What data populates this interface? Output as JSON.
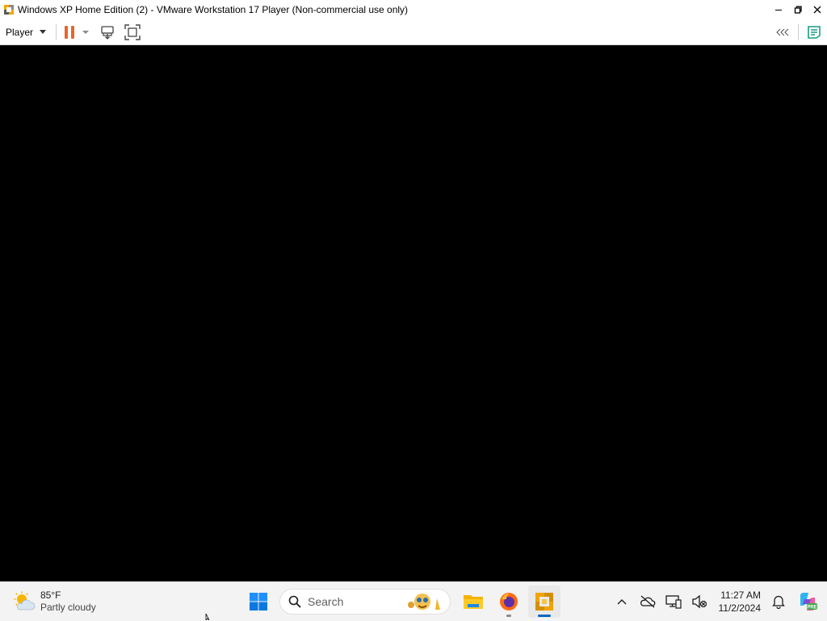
{
  "window": {
    "title": "Windows XP Home Edition (2) - VMware Workstation 17 Player (Non-commercial use only)",
    "controls": [
      "minimize-icon",
      "restore-icon",
      "close-icon"
    ]
  },
  "toolbar": {
    "player_label": "Player",
    "buttons": [
      "pause-icon",
      "send-ctrl-alt-del-icon",
      "full-screen-icon"
    ],
    "right_buttons": [
      "collapse-toolbar-icon",
      "unity-icon"
    ],
    "accent_color": "#e8662c"
  },
  "vm": {
    "screen_color": "#000000"
  },
  "taskbar": {
    "weather": {
      "temp": "85°F",
      "condition": "Partly cloudy"
    },
    "search": {
      "placeholder": "Search"
    },
    "apps": [
      "start-icon",
      "file-explorer-icon",
      "firefox-icon",
      "vmware-player-icon"
    ],
    "tray": [
      "show-hidden-icons-icon",
      "onedrive-offline-icon",
      "network-display-icon",
      "volume-muted-icon"
    ],
    "clock": {
      "time": "11:27 AM",
      "date": "11/2/2024"
    },
    "notification_icon": "bell-icon",
    "copilot_icon": "copilot-icon"
  }
}
